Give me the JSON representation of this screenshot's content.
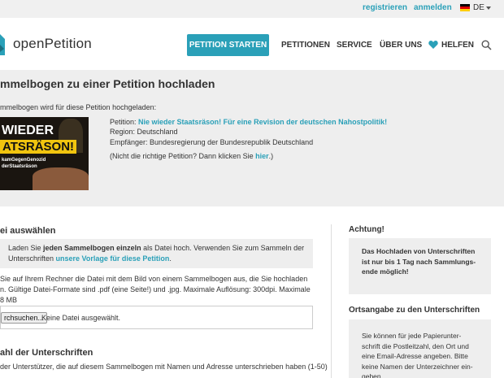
{
  "topbar": {
    "register": "registrieren",
    "login": "anmelden",
    "language": "DE"
  },
  "header": {
    "logo": "openPetition",
    "start_button": "PETITION STARTEN",
    "nav": [
      "PETITIONEN",
      "SERVICE",
      "ÜBER UNS",
      "HELFEN"
    ]
  },
  "page": {
    "title": "mmelbogen zu einer Petition hochladen",
    "intro": "mmelbogen wird für diese Petition hochgeladen:",
    "thumb": {
      "line1": "WIEDER",
      "line2": "ATSRÄSON!",
      "line3": "kamGegenGenozid",
      "line4": "derStaatsräson"
    },
    "petition_label": "Petition: ",
    "petition_link": "Nie wieder Staatsräson! Für eine Revision der deutschen Nahostpolitik!",
    "region": "Region: Deutschland",
    "recipient": "Empfänger: Bundesregierung der Bundesrepublik Deutschland",
    "wrong_prefix": "(Nicht die richtige Petition? Dann klicken Sie ",
    "wrong_link": "hier",
    "wrong_suffix": ".)"
  },
  "file_section": {
    "heading": "ei auswählen",
    "notice_a": "Laden Sie ",
    "notice_bold": "jeden Sammelbogen einzeln",
    "notice_b": " als Datei hoch. Verwenden Sie zum Sammeln der",
    "notice_c": "Unterschriften ",
    "notice_link": "unsere Vorlage für diese Petition",
    "notice_d": ".",
    "desc_line1": "Sie auf Ihrem Rechner die Datei mit dem Bild von einem Sammelbogen aus, die Sie hochladen",
    "desc_line2": "n. Gültige Datei-Formate sind .pdf (eine Seite!) und .jpg. Maximale Auflösung: 300dpi. Maximale",
    "desc_line3": "8 MB",
    "browse_button": "rchsuchen...",
    "no_file": "Keine Datei ausgewählt."
  },
  "count_section": {
    "heading": "ahl der Unterschriften",
    "desc": "der Unterstützer, die auf diesem Sammelbogen mit Namen und Adresse unterschrieben haben (1-50)"
  },
  "sidebar": {
    "warning_heading": "Achtung!",
    "warning_lines": [
      "Das Hochladen von Unterschriften",
      "ist nur bis 1 Tag nach Sammlungs-",
      "ende möglich!"
    ],
    "location_heading": "Ortsangabe zu den Unterschriften",
    "location_lines": [
      "Sie können für jede Papierunter-",
      "schrift die Postleitzahl, den Ort und",
      "eine Email-Adresse angeben. Bitte",
      "keine Namen der Unterzeichner ein-",
      "geben."
    ]
  },
  "colors": {
    "accent": "#2aa0b8",
    "background_gray": "#eeeeee"
  }
}
